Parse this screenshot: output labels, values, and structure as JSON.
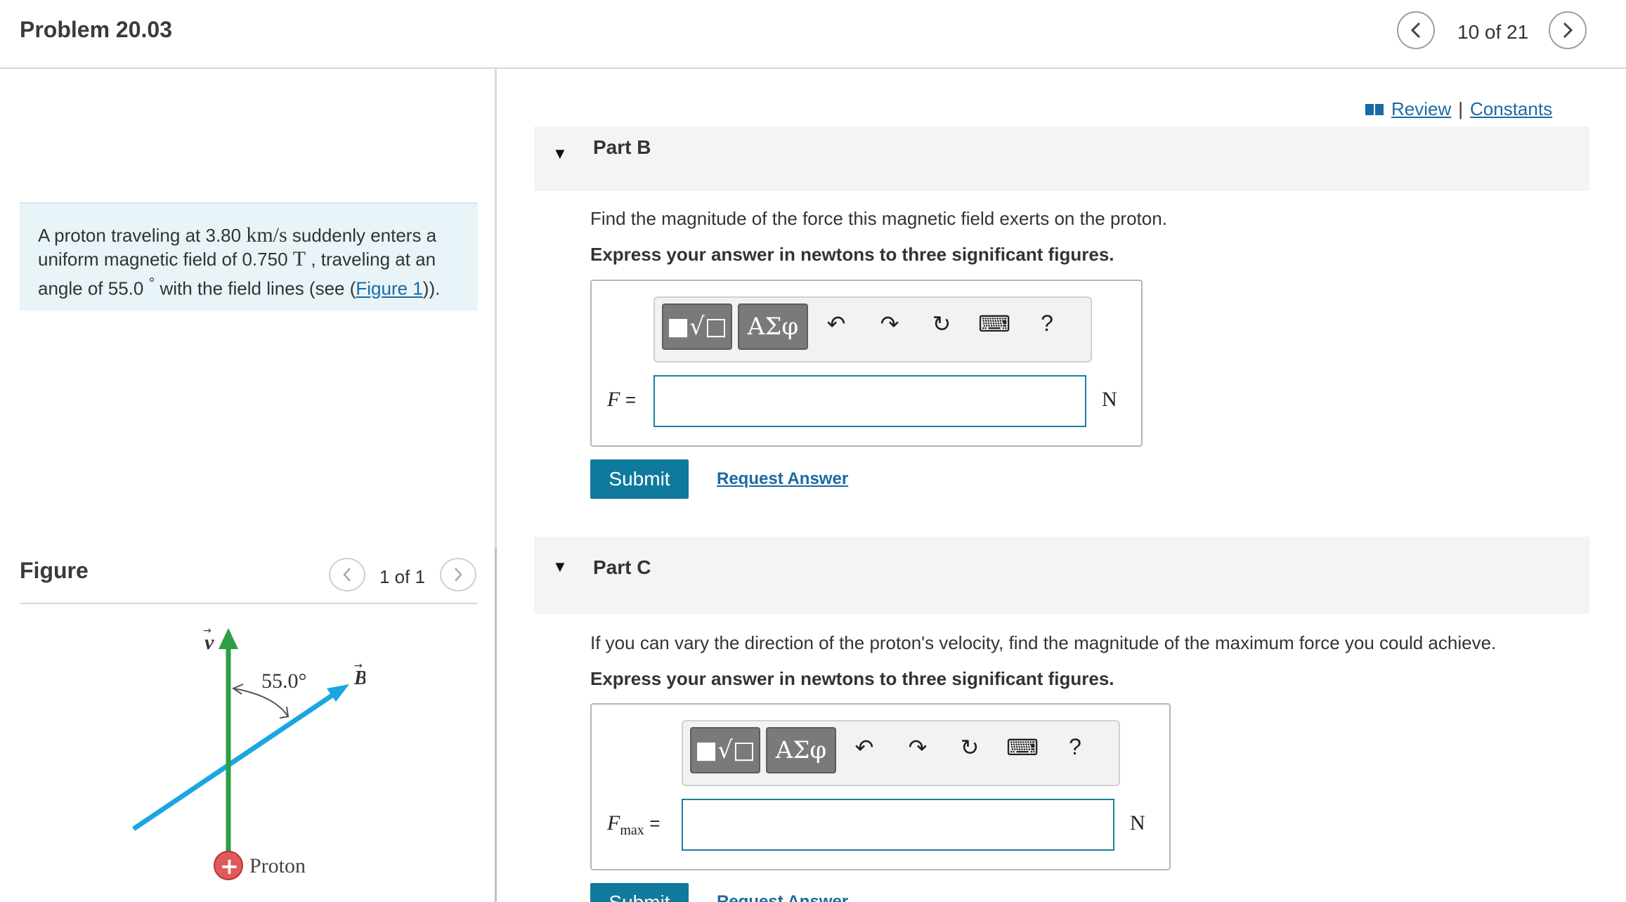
{
  "header": {
    "problem_title": "Problem 20.03",
    "prev_icon": "chevron-left-icon",
    "next_icon": "chevron-right-icon",
    "position": "10 of 21"
  },
  "problem": {
    "text_part1": "A proton traveling at 3.80 ",
    "speed_unit": "km/s",
    "text_part2": " suddenly enters a uniform magnetic field of 0.750 ",
    "field_unit": "T",
    "text_part3": " , traveling at an angle of 55.0 ",
    "degree": "°",
    "text_part4": " with the field lines (see (",
    "figure_link": "Figure 1",
    "text_part5": "))."
  },
  "figure_panel": {
    "title": "Figure",
    "count": "1 of 1",
    "angle_label": "55.0°",
    "velocity_label": "v",
    "field_label": "B",
    "proton_label": "Proton",
    "proton_sign": "+",
    "colors": {
      "velocity": "#2e9e44",
      "field": "#1aa6e0",
      "proton": "#e05a5a"
    }
  },
  "links": {
    "review": "Review",
    "separator": "|",
    "constants": "Constants"
  },
  "part_b": {
    "label": "Part B",
    "question": "Find the magnitude of the force this magnetic field exerts on the proton.",
    "instruction": "Express your answer in newtons to three significant figures.",
    "toolbar": {
      "templates": "■√□",
      "symbols": "ΑΣφ",
      "undo": "↶",
      "redo": "↷",
      "reset": "↻",
      "keyboard": "⌨",
      "help": "?"
    },
    "variable": "F",
    "equals": "=",
    "input_value": "",
    "unit": "N",
    "submit": "Submit",
    "request": "Request Answer"
  },
  "part_c": {
    "label": "Part C",
    "question": "If you can vary the direction of the proton's velocity, find the magnitude of the maximum force you could achieve.",
    "instruction": "Express your answer in newtons to three significant figures.",
    "toolbar": {
      "templates": "■√□",
      "symbols": "ΑΣφ",
      "undo": "↶",
      "redo": "↷",
      "reset": "↻",
      "keyboard": "⌨",
      "help": "?"
    },
    "variable": "F",
    "subscript": "max",
    "equals": "=",
    "input_value": "",
    "unit": "N",
    "submit": "Submit",
    "request": "Request Answer"
  }
}
